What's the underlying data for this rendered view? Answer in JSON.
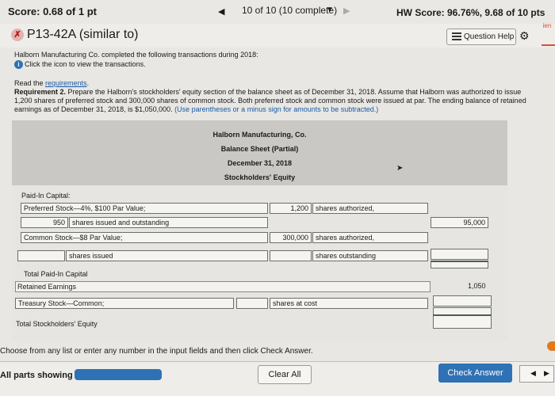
{
  "header": {
    "score": "Score: 0.68 of 1 pt",
    "nav_text": "10 of 10 (10 complete)",
    "hw_score": "HW Score: 96.76%, 9.68 of 10 pts",
    "corner_text": "ien"
  },
  "question": {
    "title": "P13-42A (similar to)",
    "help_label": "Question Help",
    "intro": "Halborn Manufacturing Co. completed the following transactions during 2018:",
    "click_info": "Click the icon to view the transactions.",
    "read_prefix": "Read the ",
    "requirements_link": "requirements",
    "read_suffix": ".",
    "req_label": "Requirement 2.",
    "req_text": " Prepare the Halborn's stockholders' equity section of the balance sheet as of December 31, 2018. Assume that Halborn was authorized to issue 1,200 shares of preferred stock and 300,000 shares of common stock. Both preferred stock and common stock were issued at par. The ending balance of retained earnings as of December 31, 2018, is $1,050,000. ",
    "req_hint": "(Use parentheses or a minus sign for amounts to be subtracted.)"
  },
  "statement": {
    "company": "Halborn Manufacturing, Co.",
    "title": "Balance Sheet (Partial)",
    "date": "December 31, 2018",
    "section": "Stockholders' Equity",
    "paid_in_capital": "Paid-In Capital:",
    "preferred_label": "Preferred Stock—4%, $100 Par Value;",
    "pref_authorized_value": "1,200",
    "shares_authorized": "shares authorized,",
    "pref_issued_value": "950",
    "issued_outstanding": "shares issued and outstanding",
    "pref_amount": "95,000",
    "common_label": "Common Stock—$8 Par Value;",
    "common_authorized_value": "300,000",
    "shares_issued": "shares issued",
    "shares_outstanding": "shares outstanding",
    "total_paid_in": "Total Paid-In Capital",
    "retained_earnings": "Retained Earnings",
    "retained_amount": "1,050",
    "treasury_label": "Treasury Stock—Common;",
    "shares_at_cost": "shares at cost",
    "total_equity": "Total Stockholders' Equity"
  },
  "footer": {
    "instruction": "Choose from any list or enter any number in the input fields and then click Check Answer.",
    "all_parts": "All parts showing",
    "clear_all": "Clear All",
    "check_answer": "Check Answer"
  },
  "colors": {
    "accent": "#2f71b5",
    "link": "#1a5aa8"
  }
}
